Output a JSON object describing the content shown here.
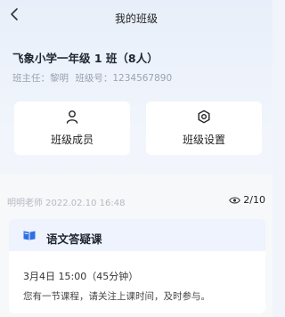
{
  "header": {
    "title": "我的班级",
    "back_icon": "chevron-left-icon"
  },
  "class_info": {
    "name": "飞象小学一年级 1 班（8人）",
    "teacher_label": "班主任：黎明",
    "class_no_label": "班级号：1234567890"
  },
  "actions": [
    {
      "label": "班级成员",
      "icon": "person-icon"
    },
    {
      "label": "班级设置",
      "icon": "gear-icon"
    }
  ],
  "notice": {
    "author_date": "明明老师  2022.02.10 16:48",
    "views": "2/10",
    "views_icon": "eye-icon",
    "title": "语文答疑课",
    "title_icon": "book-icon",
    "time": "3月4日 15:00（45分钟）",
    "description": "您有一节课程，请关注上课时间，及时参与。"
  },
  "colors": {
    "accent": "#2f6fe6",
    "notice_header_bg": "#eef3fd",
    "meta_text": "#9aa3b1"
  }
}
